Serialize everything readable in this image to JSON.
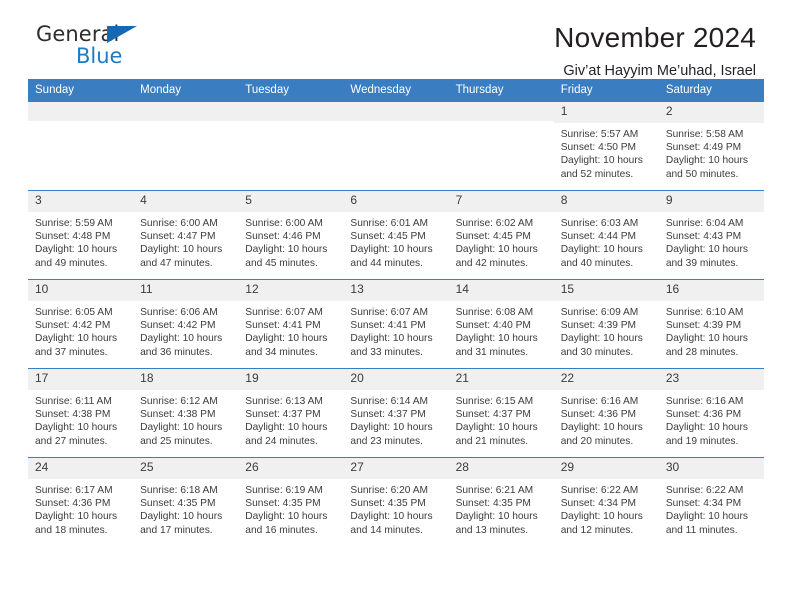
{
  "brand": {
    "line1": "General",
    "line2": "Blue",
    "triangle_color": "#1668b3",
    "blue_text_color": "#1b7bc4"
  },
  "header": {
    "title": "November 2024",
    "subtitle": "Giv’at Hayyim Me’uhad, Israel"
  },
  "theme": {
    "header_blue": "#3a7dc0",
    "daynum_bg": "#f0f0f0",
    "text": "#3c3c3c"
  },
  "labels": {
    "sunrise": "Sunrise:",
    "sunset": "Sunset:",
    "daylight": "Daylight:"
  },
  "weekdays": [
    "Sunday",
    "Monday",
    "Tuesday",
    "Wednesday",
    "Thursday",
    "Friday",
    "Saturday"
  ],
  "weeks": [
    [
      {
        "day": "",
        "blank": true
      },
      {
        "day": "",
        "blank": true
      },
      {
        "day": "",
        "blank": true
      },
      {
        "day": "",
        "blank": true
      },
      {
        "day": "",
        "blank": true
      },
      {
        "day": "1",
        "sunrise": "Sunrise: 5:57 AM",
        "sunset": "Sunset: 4:50 PM",
        "daylight": "Daylight: 10 hours and 52 minutes."
      },
      {
        "day": "2",
        "sunrise": "Sunrise: 5:58 AM",
        "sunset": "Sunset: 4:49 PM",
        "daylight": "Daylight: 10 hours and 50 minutes."
      }
    ],
    [
      {
        "day": "3",
        "sunrise": "Sunrise: 5:59 AM",
        "sunset": "Sunset: 4:48 PM",
        "daylight": "Daylight: 10 hours and 49 minutes."
      },
      {
        "day": "4",
        "sunrise": "Sunrise: 6:00 AM",
        "sunset": "Sunset: 4:47 PM",
        "daylight": "Daylight: 10 hours and 47 minutes."
      },
      {
        "day": "5",
        "sunrise": "Sunrise: 6:00 AM",
        "sunset": "Sunset: 4:46 PM",
        "daylight": "Daylight: 10 hours and 45 minutes."
      },
      {
        "day": "6",
        "sunrise": "Sunrise: 6:01 AM",
        "sunset": "Sunset: 4:45 PM",
        "daylight": "Daylight: 10 hours and 44 minutes."
      },
      {
        "day": "7",
        "sunrise": "Sunrise: 6:02 AM",
        "sunset": "Sunset: 4:45 PM",
        "daylight": "Daylight: 10 hours and 42 minutes."
      },
      {
        "day": "8",
        "sunrise": "Sunrise: 6:03 AM",
        "sunset": "Sunset: 4:44 PM",
        "daylight": "Daylight: 10 hours and 40 minutes."
      },
      {
        "day": "9",
        "sunrise": "Sunrise: 6:04 AM",
        "sunset": "Sunset: 4:43 PM",
        "daylight": "Daylight: 10 hours and 39 minutes."
      }
    ],
    [
      {
        "day": "10",
        "sunrise": "Sunrise: 6:05 AM",
        "sunset": "Sunset: 4:42 PM",
        "daylight": "Daylight: 10 hours and 37 minutes."
      },
      {
        "day": "11",
        "sunrise": "Sunrise: 6:06 AM",
        "sunset": "Sunset: 4:42 PM",
        "daylight": "Daylight: 10 hours and 36 minutes."
      },
      {
        "day": "12",
        "sunrise": "Sunrise: 6:07 AM",
        "sunset": "Sunset: 4:41 PM",
        "daylight": "Daylight: 10 hours and 34 minutes."
      },
      {
        "day": "13",
        "sunrise": "Sunrise: 6:07 AM",
        "sunset": "Sunset: 4:41 PM",
        "daylight": "Daylight: 10 hours and 33 minutes."
      },
      {
        "day": "14",
        "sunrise": "Sunrise: 6:08 AM",
        "sunset": "Sunset: 4:40 PM",
        "daylight": "Daylight: 10 hours and 31 minutes."
      },
      {
        "day": "15",
        "sunrise": "Sunrise: 6:09 AM",
        "sunset": "Sunset: 4:39 PM",
        "daylight": "Daylight: 10 hours and 30 minutes."
      },
      {
        "day": "16",
        "sunrise": "Sunrise: 6:10 AM",
        "sunset": "Sunset: 4:39 PM",
        "daylight": "Daylight: 10 hours and 28 minutes."
      }
    ],
    [
      {
        "day": "17",
        "sunrise": "Sunrise: 6:11 AM",
        "sunset": "Sunset: 4:38 PM",
        "daylight": "Daylight: 10 hours and 27 minutes."
      },
      {
        "day": "18",
        "sunrise": "Sunrise: 6:12 AM",
        "sunset": "Sunset: 4:38 PM",
        "daylight": "Daylight: 10 hours and 25 minutes."
      },
      {
        "day": "19",
        "sunrise": "Sunrise: 6:13 AM",
        "sunset": "Sunset: 4:37 PM",
        "daylight": "Daylight: 10 hours and 24 minutes."
      },
      {
        "day": "20",
        "sunrise": "Sunrise: 6:14 AM",
        "sunset": "Sunset: 4:37 PM",
        "daylight": "Daylight: 10 hours and 23 minutes."
      },
      {
        "day": "21",
        "sunrise": "Sunrise: 6:15 AM",
        "sunset": "Sunset: 4:37 PM",
        "daylight": "Daylight: 10 hours and 21 minutes."
      },
      {
        "day": "22",
        "sunrise": "Sunrise: 6:16 AM",
        "sunset": "Sunset: 4:36 PM",
        "daylight": "Daylight: 10 hours and 20 minutes."
      },
      {
        "day": "23",
        "sunrise": "Sunrise: 6:16 AM",
        "sunset": "Sunset: 4:36 PM",
        "daylight": "Daylight: 10 hours and 19 minutes."
      }
    ],
    [
      {
        "day": "24",
        "sunrise": "Sunrise: 6:17 AM",
        "sunset": "Sunset: 4:36 PM",
        "daylight": "Daylight: 10 hours and 18 minutes."
      },
      {
        "day": "25",
        "sunrise": "Sunrise: 6:18 AM",
        "sunset": "Sunset: 4:35 PM",
        "daylight": "Daylight: 10 hours and 17 minutes."
      },
      {
        "day": "26",
        "sunrise": "Sunrise: 6:19 AM",
        "sunset": "Sunset: 4:35 PM",
        "daylight": "Daylight: 10 hours and 16 minutes."
      },
      {
        "day": "27",
        "sunrise": "Sunrise: 6:20 AM",
        "sunset": "Sunset: 4:35 PM",
        "daylight": "Daylight: 10 hours and 14 minutes."
      },
      {
        "day": "28",
        "sunrise": "Sunrise: 6:21 AM",
        "sunset": "Sunset: 4:35 PM",
        "daylight": "Daylight: 10 hours and 13 minutes."
      },
      {
        "day": "29",
        "sunrise": "Sunrise: 6:22 AM",
        "sunset": "Sunset: 4:34 PM",
        "daylight": "Daylight: 10 hours and 12 minutes."
      },
      {
        "day": "30",
        "sunrise": "Sunrise: 6:22 AM",
        "sunset": "Sunset: 4:34 PM",
        "daylight": "Daylight: 10 hours and 11 minutes."
      }
    ]
  ]
}
